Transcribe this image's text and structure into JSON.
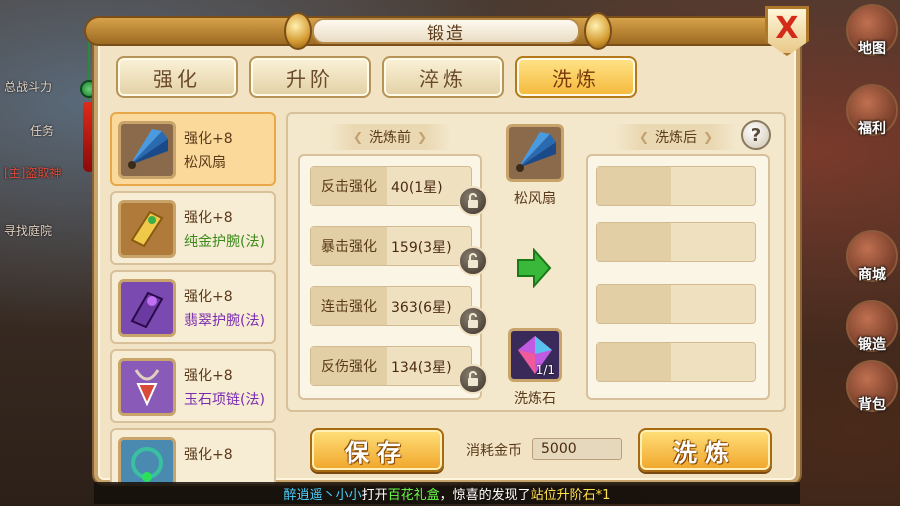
{
  "window": {
    "title": "锻造",
    "close_label": "X"
  },
  "tabs": [
    {
      "label": "强化",
      "active": false
    },
    {
      "label": "升阶",
      "active": false
    },
    {
      "label": "淬炼",
      "active": false
    },
    {
      "label": "洗炼",
      "active": true
    }
  ],
  "items": [
    {
      "level": "强化+8",
      "name": "松风扇",
      "name_color": "#5a3a1a",
      "icon": "fan-icon",
      "selected": true
    },
    {
      "level": "强化+8",
      "name": "纯金护腕(法)",
      "name_color": "#3a8a1a",
      "icon": "bracer-icon",
      "selected": false
    },
    {
      "level": "强化+8",
      "name": "翡翠护腕(法)",
      "name_color": "#7a2ab0",
      "icon": "bracer-icon",
      "selected": false
    },
    {
      "level": "强化+8",
      "name": "玉石项链(法)",
      "name_color": "#7a2ab0",
      "icon": "necklace-icon",
      "selected": false
    },
    {
      "level": "强化+8",
      "name": "",
      "name_color": "#7a2ab0",
      "icon": "necklace-icon",
      "selected": false
    }
  ],
  "before": {
    "header": "洗炼前",
    "stats": [
      {
        "label": "反击强化",
        "value": "40(1星)"
      },
      {
        "label": "暴击强化",
        "value": "159(3星)"
      },
      {
        "label": "连击强化",
        "value": "363(6星)"
      },
      {
        "label": "反伤强化",
        "value": "134(3星)"
      }
    ]
  },
  "center": {
    "item_name": "松风扇",
    "stone_name": "洗炼石",
    "stone_count": "1/1"
  },
  "after": {
    "header": "洗炼后",
    "help_label": "?"
  },
  "actions": {
    "save_label": "保存",
    "refine_label": "洗炼",
    "cost_label": "消耗金币",
    "cost_value": "5000"
  },
  "chat": {
    "player": "醉逍遥丶小小",
    "text1": "打开",
    "gift": "百花礼盒",
    "text2": "，惊喜的发现了",
    "reward": "站位升阶石*1"
  },
  "hud": {
    "side_buttons": [
      "地图",
      "福利",
      "商城",
      "锻造",
      "背包"
    ],
    "left_texts": [
      "总战斗力",
      "任务",
      "[主]盗取神",
      "寻找庭院"
    ]
  },
  "colors": {
    "accent_gold": "#f4b83a",
    "panel_bg": "#f1e3c4",
    "close_red": "#d42a1a",
    "arrow_green": "#3ab83a"
  }
}
